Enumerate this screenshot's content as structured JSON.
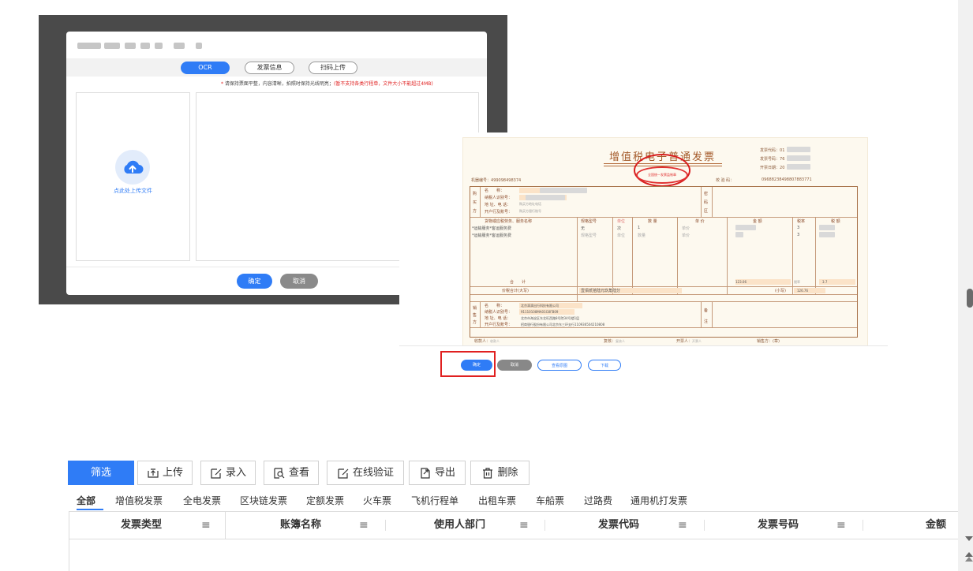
{
  "upload_dialog": {
    "tabs": [
      "OCR",
      "发票信息",
      "扫码上传"
    ],
    "note_star": "*",
    "note_main": "请保持票面平整，内容清晰，拍照时保持光线明亮；",
    "note_red": "(暂不支持各类行程单，文件大小不能超过4MB)",
    "upload_label": "点此处上传文件",
    "confirm": "确定",
    "cancel": "取消"
  },
  "invoice": {
    "title": "增值税电子普通发票",
    "seal_text": "全国统一发票监制章",
    "code_label": "发票代码：",
    "code_value": "01",
    "number_label": "发票号码：",
    "number_value": "76",
    "date_label": "开票日期：",
    "date_value": "20",
    "machine_label": "机器编号：",
    "machine_value": "499098498374",
    "check_label": "校 验 码：",
    "check_value": "09688238498807883771",
    "buyer_side": [
      "购",
      "买",
      "方"
    ],
    "buyer_fields": [
      "名　　称：",
      "纳税人识别号：",
      "地 址、电 话：",
      "开户行及账号："
    ],
    "buyer_values": [
      "",
      "",
      "购买方地址电话",
      "购买方银行账号"
    ],
    "password_side": [
      "密",
      "码",
      "区"
    ],
    "items_header": [
      "货物或应税劳务、服务名称",
      "规格型号",
      "单位",
      "数 量",
      "单 价",
      "金 额",
      "税率",
      "税 额"
    ],
    "items": [
      {
        "name": "*运输服务*客运服务费",
        "spec": "无",
        "unit": "次",
        "qty": "1",
        "price": "单价",
        "rate": "3"
      },
      {
        "name": "*运输服务*客运服务费",
        "spec": "规格型号",
        "unit": "单位",
        "qty": "数量",
        "price": "单价",
        "rate": "3"
      }
    ],
    "total_label": "合　　计",
    "total_amount": "123.06",
    "total_rate": "税率",
    "total_tax": "3.7",
    "price_tax_label": "价税合计(大写)",
    "price_tax_words": "壹佰贰拾陆元玖角陆分",
    "price_tax_small_label": "(小写)",
    "price_tax_small_value": "126.76",
    "seller_side": [
      "销",
      "售",
      "方"
    ],
    "seller_fields": [
      "名　　称：",
      "纳税人识别号：",
      "地 址、电 话：",
      "开户行及账号："
    ],
    "seller_values": [
      "北京滴滴出行科技有限公司",
      "91110108MA01G0FB09",
      "北京市海淀区东北旺西路8号院34号楼1层",
      "招商银行股份有限公司北京东三环支行110936504210808"
    ],
    "remark_side": [
      "备",
      "注"
    ],
    "payee_label": "收款人：",
    "payee_value": "收款人",
    "reviewer_label": "复核：",
    "reviewer_value": "复核人",
    "drawer_label": "开票人：",
    "drawer_value": "开票人",
    "seller_stamp": "销售方：(章)",
    "buttons": [
      "确定",
      "取消",
      "查看原图",
      "下载"
    ]
  },
  "toolbar": {
    "filter": "筛选",
    "upload": "上传",
    "entry": "录入",
    "view": "查看",
    "verify": "在线验证",
    "export": "导出",
    "delete": "删除"
  },
  "tabs": [
    "全部",
    "增值税发票",
    "全电发票",
    "区块链发票",
    "定额发票",
    "火车票",
    "飞机行程单",
    "出租车票",
    "车船票",
    "过路费",
    "通用机打发票"
  ],
  "table": {
    "columns": [
      "发票类型",
      "账簿名称",
      "使用人部门",
      "发票代码",
      "发票号码",
      "金额"
    ],
    "menu_glyph": "≡"
  },
  "colors": {
    "primary": "#2f7cf6",
    "highlight_box": "#e02020",
    "invoice_brown": "#a45a2a"
  }
}
